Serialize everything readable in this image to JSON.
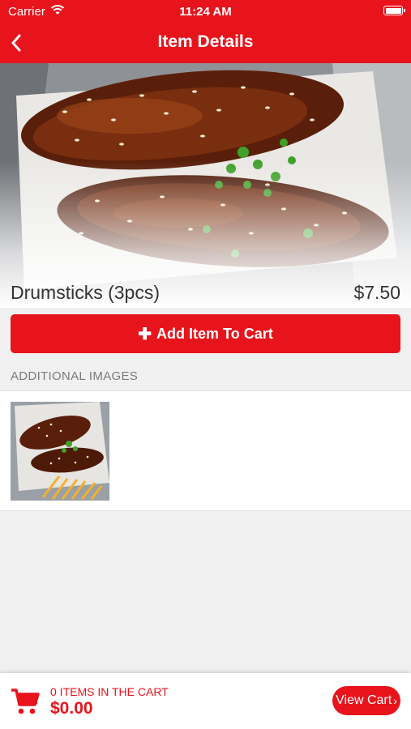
{
  "status_bar": {
    "carrier": "Carrier",
    "time": "11:24 AM"
  },
  "nav": {
    "title": "Item Details",
    "back_icon": "chevron-left-icon"
  },
  "item": {
    "name": "Drumsticks (3pcs)",
    "price": "$7.50"
  },
  "add_button": {
    "icon": "plus-icon",
    "label": "Add Item To Cart"
  },
  "additional_images": {
    "header": "ADDITIONAL IMAGES"
  },
  "cart": {
    "icon": "cart-icon",
    "items_label": "0 ITEMS IN THE CART",
    "total": "$0.00",
    "view_cart_label": "View Cart"
  },
  "colors": {
    "accent": "#e8141c",
    "background": "#f0f0f0"
  }
}
